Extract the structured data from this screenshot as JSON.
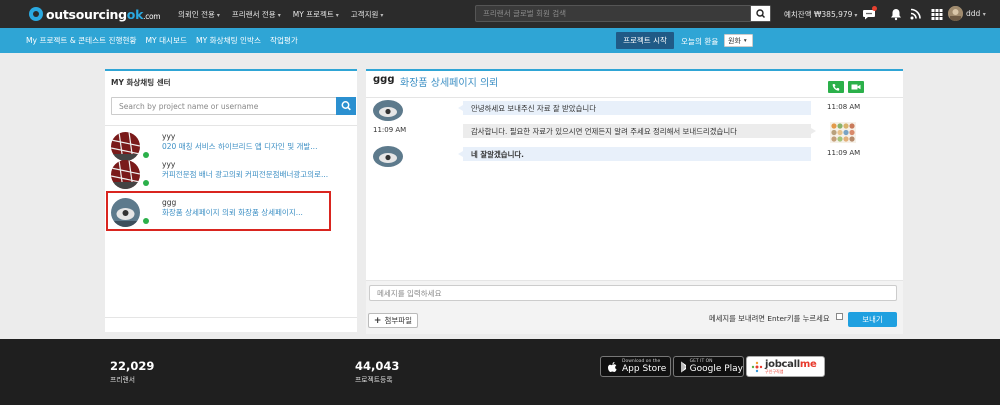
{
  "header": {
    "logo_main": "outsourcing",
    "logo_accent": "ok",
    "logo_tld": ".com",
    "nav": [
      {
        "label": "의뢰인 전용"
      },
      {
        "label": "프리랜서 전용"
      },
      {
        "label": "MY 프로젝트"
      },
      {
        "label": "고객지원"
      }
    ],
    "search_placeholder": "프리랜서 글로벌 회원 검색",
    "deposit_label": "예치잔액 ₩385,979",
    "user_name": "ddd",
    "icons": [
      "search-icon",
      "chat-bubble-icon",
      "bell-icon",
      "rss-icon",
      "grid-icon"
    ],
    "chat_badge_color": "#e8402f"
  },
  "subbar": {
    "items": [
      {
        "label": "My 프로젝트 & 콘테스트 진행현황"
      },
      {
        "label": "MY 대시보드"
      },
      {
        "label": "MY 화상채팅 인박스"
      },
      {
        "label": "작업평가"
      }
    ],
    "start_button": "프로젝트 시작",
    "rate_label": "오늘의 환율",
    "currency": "원화",
    "accent_color": "#2fa5d5"
  },
  "chat_list": {
    "title": "MY 화상채팅 센터",
    "search_placeholder": "Search by project name or username",
    "rooms": [
      {
        "name": "yyy",
        "preview": "020 매칭 서비스 하이브리드 앱 디자인 및 개발..."
      },
      {
        "name": "yyy",
        "preview": "커피전문점 배너 광고의뢰 커피전문점배너광고의로..."
      },
      {
        "name": "ggg",
        "preview": "화장품 상세페이지 의뢰 화장품 상세페이지..."
      }
    ],
    "online_color": "#2bb04a"
  },
  "chat": {
    "partner_name": "ggg",
    "title": "화장품 상세페이지 의뢰",
    "messages": [
      {
        "text": "안녕하세요 보내주신 자료 잘 받았습니다",
        "time": "11:08 AM",
        "side": "incoming"
      },
      {
        "text": "감사합니다. 필요한 자료가 있으시면 언제든지 알려 주세요 정리해서 보내드리겠습니다",
        "time": "11:09 AM",
        "side": "outgoing"
      },
      {
        "text": "네 잘알겠습니다.",
        "time": "11:09 AM",
        "side": "incoming"
      }
    ],
    "input_placeholder": "메세지를 입력하세요",
    "attach_label": "첨부파일",
    "enter_note": "메세지를 보내려면 Enter키를 누르세요",
    "send_label": "보내기"
  },
  "footer": {
    "stats": [
      {
        "value": "22,029",
        "label": "프리랜서"
      },
      {
        "value": "44,043",
        "label": "프로젝트등록"
      }
    ],
    "stores": [
      {
        "small": "Download on the",
        "big": "App Store"
      },
      {
        "small": "GET IT ON",
        "big": "Google Play"
      }
    ],
    "jobcall_main": "jobcall",
    "jobcall_accent": "me",
    "jobcall_sub": "구인구직앱"
  }
}
